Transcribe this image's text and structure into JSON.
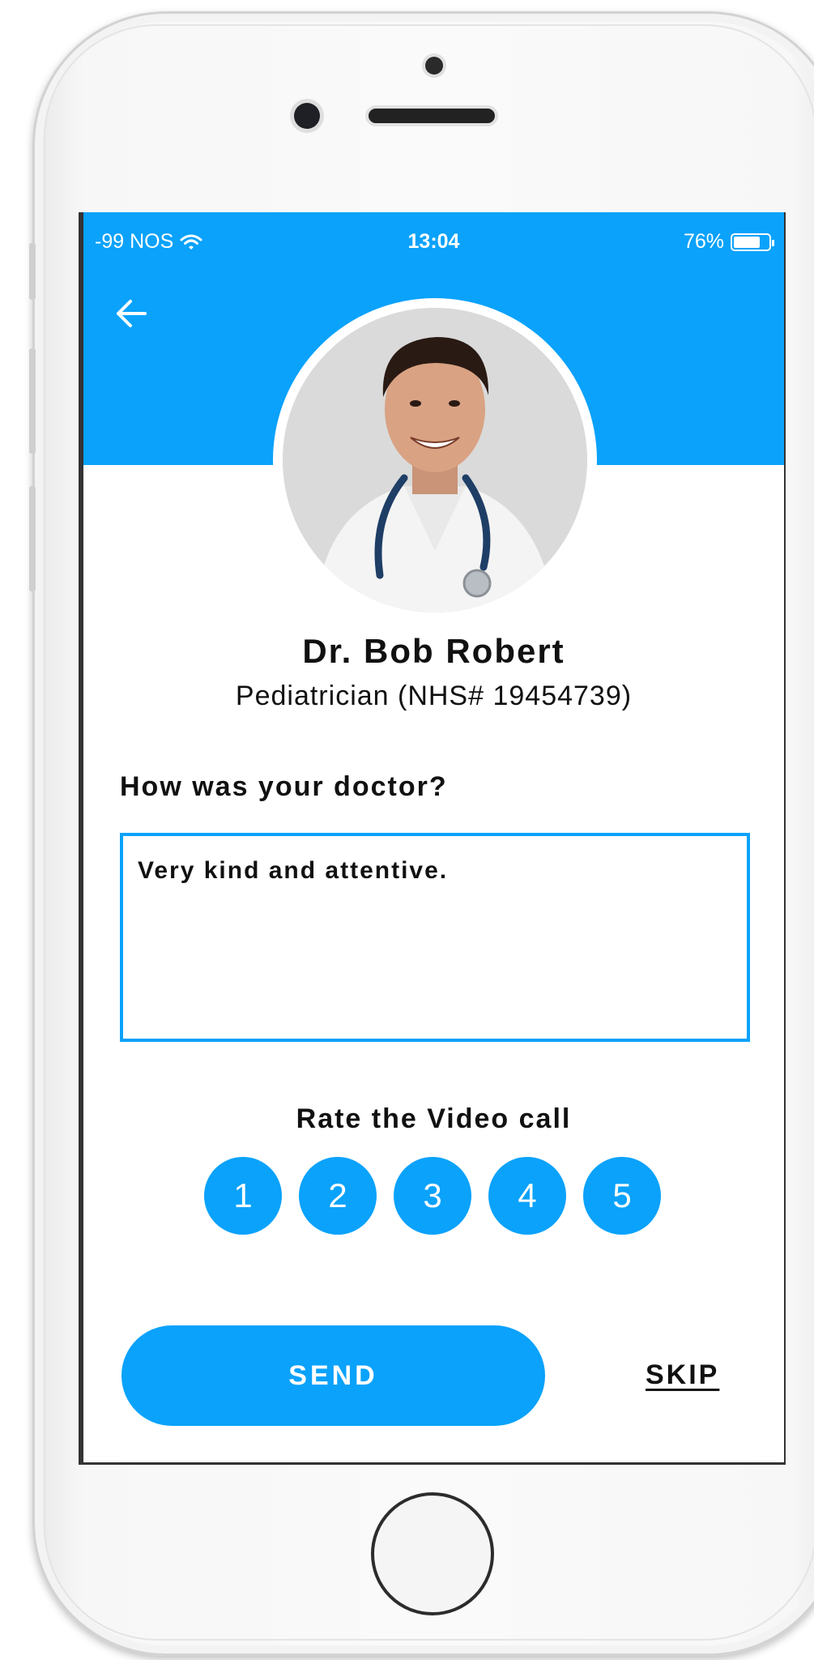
{
  "status_bar": {
    "carrier": "-99 NOS",
    "time": "13:04",
    "battery_percent_label": "76%",
    "battery_level": 0.76
  },
  "header": {
    "back_icon": "arrow-left-icon"
  },
  "doctor": {
    "name": "Dr. Bob Robert",
    "specialty": "Pediatrician (NHS# 19454739)"
  },
  "feedback": {
    "question": "How was your doctor?",
    "review_text": "Very kind and attentive."
  },
  "rating": {
    "title": "Rate the Video call",
    "options": [
      "1",
      "2",
      "3",
      "4",
      "5"
    ]
  },
  "actions": {
    "send_label": "SEND",
    "skip_label": "SKIP"
  },
  "colors": {
    "accent": "#0aa2fb"
  }
}
